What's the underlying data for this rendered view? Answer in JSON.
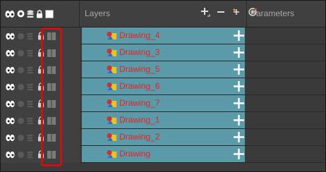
{
  "header": {
    "layers_label": "Layers",
    "parameters_label": "Parameters",
    "tools": [
      "add-layer-icon",
      "remove-layer-icon",
      "add-peg-icon",
      "add-drawing-icon"
    ]
  },
  "layers": [
    {
      "name": "Drawing_4"
    },
    {
      "name": "Drawing_3"
    },
    {
      "name": "Drawing_5"
    },
    {
      "name": "Drawing_6"
    },
    {
      "name": "Drawing_7"
    },
    {
      "name": "Drawing_1"
    },
    {
      "name": "Drawing_2"
    },
    {
      "name": "Drawing"
    }
  ],
  "colors": {
    "layer_bg": "#5b9aa8",
    "layer_name": "#e32424",
    "highlight": "#d01010"
  }
}
